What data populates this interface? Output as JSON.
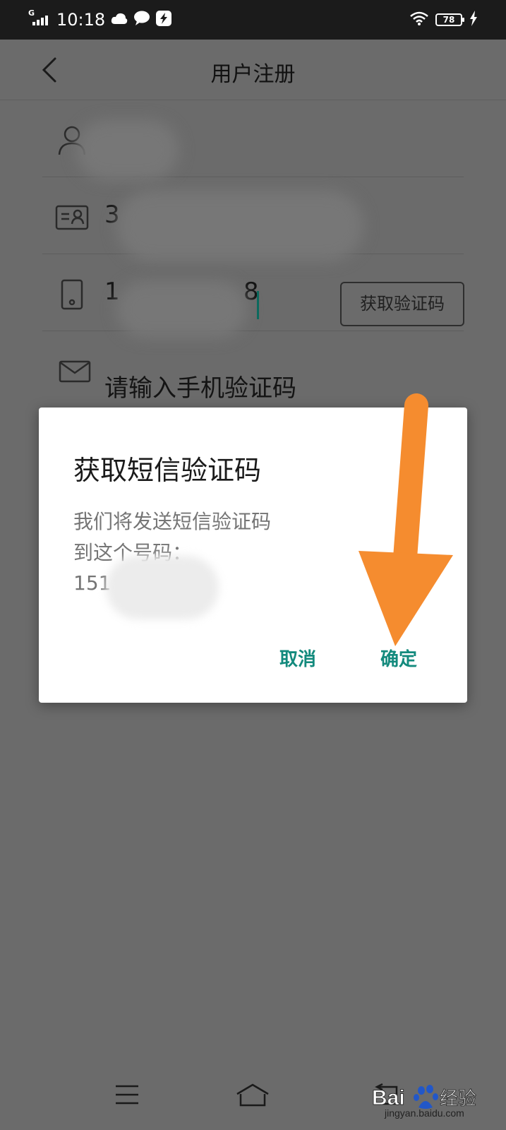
{
  "status_bar": {
    "network_type": "G",
    "time": "10:18",
    "battery": "78"
  },
  "header": {
    "title": "用户注册"
  },
  "form": {
    "username_value": "",
    "id_value": "3",
    "phone_prefix": "1",
    "phone_suffix": "8",
    "get_code_label": "获取验证码",
    "sms_code_placeholder": "请输入手机验证码"
  },
  "dialog": {
    "title": "获取短信验证码",
    "message_line1": "我们将发送短信验证码",
    "message_line2": "到这个号码：",
    "phone_prefix": "151",
    "cancel_label": "取消",
    "confirm_label": "确定"
  },
  "colors": {
    "accent": "#138a7d",
    "annotation_arrow": "#f58c2f",
    "scrim": "#6b6b6b"
  },
  "icons": {
    "back": "chevron-left-icon",
    "user": "user-icon",
    "id_card": "id-card-icon",
    "phone": "phone-icon",
    "mail": "mail-icon",
    "menu": "menu-icon",
    "home": "home-icon",
    "return": "back-nav-icon"
  }
}
